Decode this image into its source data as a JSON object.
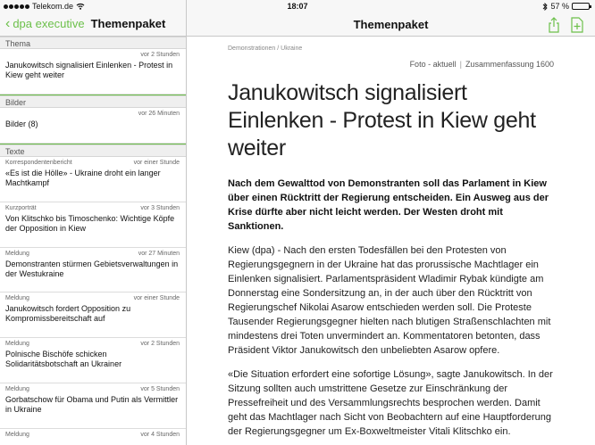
{
  "status": {
    "carrier": "Telekom.de",
    "time": "18:07",
    "battery": "57 %",
    "battery_level": 0.57
  },
  "leftnav": {
    "back_label": "dpa executive",
    "title": "Themenpaket"
  },
  "rightnav": {
    "title": "Themenpaket"
  },
  "sidebar": {
    "sections": [
      {
        "label": "Thema",
        "items": [
          {
            "type": "",
            "time": "vor 2 Stunden",
            "title": "Janukowitsch signalisiert Einlenken - Protest in Kiew geht weiter"
          }
        ]
      },
      {
        "label": "Bilder",
        "items": [
          {
            "type": "",
            "time": "vor 26 Minuten",
            "title": "Bilder (8)"
          }
        ]
      },
      {
        "label": "Texte",
        "items": [
          {
            "type": "Korrespondentenbericht",
            "time": "vor einer Stunde",
            "title": "«Es ist die Hölle» - Ukraine droht ein langer Machtkampf"
          },
          {
            "type": "Kurzporträt",
            "time": "vor 3 Stunden",
            "title": "Von Klitschko bis Timoschenko: Wichtige Köpfe der Opposition in Kiew"
          },
          {
            "type": "Meldung",
            "time": "vor 27 Minuten",
            "title": "Demonstranten stürmen Gebietsverwaltungen in der Westukraine"
          },
          {
            "type": "Meldung",
            "time": "vor einer Stunde",
            "title": "Janukowitsch fordert Opposition zu Kompromissbereitschaft auf"
          },
          {
            "type": "Meldung",
            "time": "vor 2 Stunden",
            "title": "Polnische Bischöfe schicken Solidaritätsbotschaft an Ukrainer"
          },
          {
            "type": "Meldung",
            "time": "vor 5 Stunden",
            "title": "Gorbatschow für Obama und Putin als Vermittler in Ukraine"
          },
          {
            "type": "Meldung",
            "time": "vor 4 Stunden",
            "title": ""
          }
        ]
      }
    ]
  },
  "article": {
    "breadcrumb": "Demonstrationen  /  Ukraine",
    "meta_left": "Foto - aktuell",
    "meta_sep": "|",
    "meta_right": "Zusammenfassung 1600",
    "headline": "Janukowitsch signalisiert Einlenken - Protest in Kiew geht weiter",
    "lead": "Nach dem Gewalttod von Demonstranten soll das Parlament in Kiew über einen Rücktritt der Regierung entscheiden. Ein Ausweg aus der Krise dürfte aber nicht leicht werden. Der Westen droht mit Sanktionen.",
    "paragraphs": [
      "Kiew (dpa) - Nach den ersten Todesfällen bei den Protesten von Regierungsgegnern in der Ukraine hat das prorussische Machtlager ein Einlenken signalisiert. Parlamentspräsident Wladimir Rybak kündigte am Donnerstag eine Sondersitzung an, in der auch über den Rücktritt von Regierungschef Nikolai Asarow entschieden werden soll. Die Proteste Tausender Regierungsgegner hielten nach blutigen Straßenschlachten mit mindestens drei Toten unvermindert an. Kommentatoren betonten, dass Präsident Viktor Janukowitsch den unbeliebten Asarow opfere.",
      "«Die Situation erfordert eine sofortige Lösung», sagte Janukowitsch. In der Sitzung sollten auch umstrittene Gesetze zur Einschränkung der Pressefreiheit und des Versammlungsrechts besprochen werden. Damit geht das Machtlager nach Sicht von Beobachtern auf eine Hauptforderung der Regierungsgegner um Ex-Boxweltmeister Vitali Klitschko ein."
    ]
  },
  "colors": {
    "accent": "#6cc04a"
  },
  "icons": {
    "share": "share-icon",
    "add": "add-icon",
    "back": "chevron-left-icon",
    "wifi": "wifi-icon",
    "bluetooth": "bluetooth-icon"
  }
}
